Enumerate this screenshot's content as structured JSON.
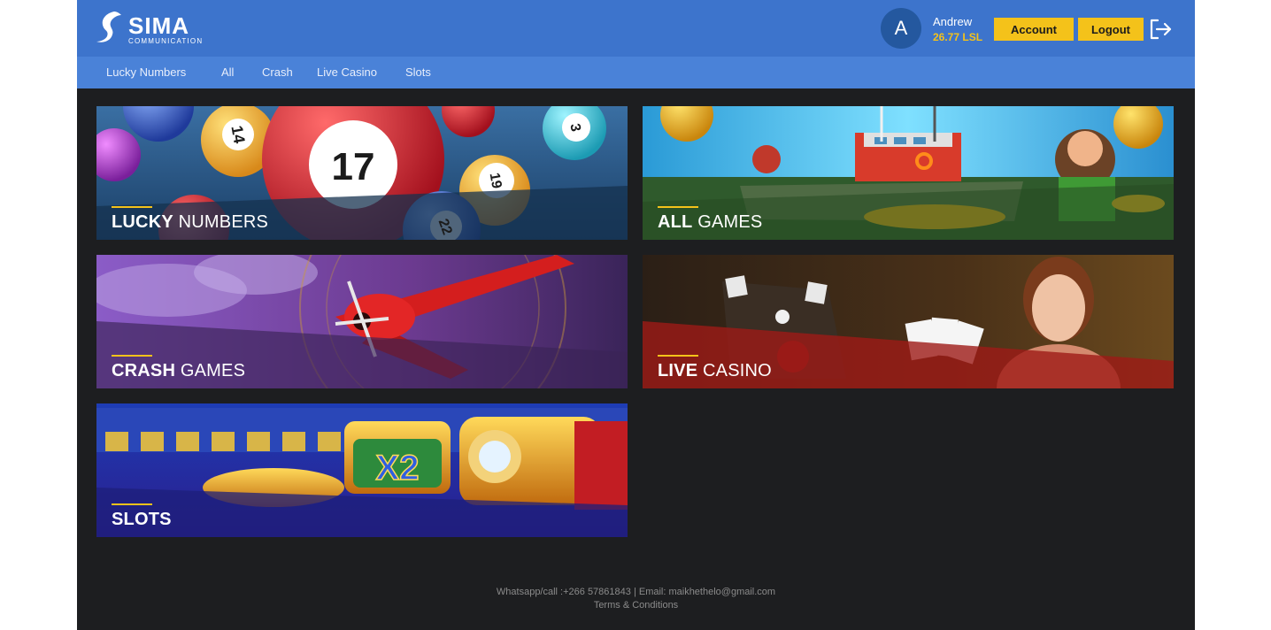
{
  "brand": {
    "name": "SIMA",
    "subtitle": "COMMUNICATION"
  },
  "user": {
    "avatar_letter": "A",
    "name": "Andrew",
    "balance": "26.77 LSL"
  },
  "header": {
    "account_label": "Account",
    "logout_label": "Logout"
  },
  "nav": {
    "items": [
      {
        "label": "Lucky Numbers"
      },
      {
        "label": "All"
      },
      {
        "label": "Crash"
      },
      {
        "label": "Live Casino"
      },
      {
        "label": "Slots"
      }
    ]
  },
  "cards": [
    {
      "title_bold": "LUCKY",
      "title_light": " NUMBERS"
    },
    {
      "title_bold": "ALL",
      "title_light": " GAMES"
    },
    {
      "title_bold": "CRASH",
      "title_light": " GAMES"
    },
    {
      "title_bold": "LIVE",
      "title_light": " CASINO"
    },
    {
      "title_bold": "SLOTS",
      "title_light": ""
    }
  ],
  "ball_numbers": [
    "14",
    "17",
    "3",
    "19",
    "22"
  ],
  "footer": {
    "contact": "Whatsapp/call :+266 57861843  |  Email: maikhethelo@gmail.com",
    "terms": "Terms & Conditions"
  },
  "colors": {
    "header": "#3d74cc",
    "nav": "#4a82d8",
    "accent": "#f4c21a",
    "background": "#1d1e20"
  }
}
